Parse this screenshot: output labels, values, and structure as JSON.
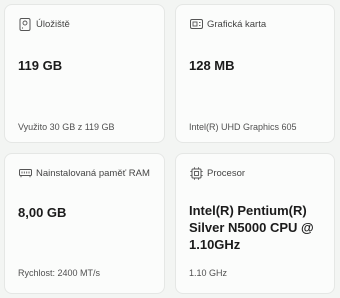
{
  "cards": [
    {
      "icon": "storage-icon",
      "label": "Úložiště",
      "value": "119 GB",
      "detail": "Využito 30 GB z 119 GB"
    },
    {
      "icon": "graphics-card-icon",
      "label": "Grafická karta",
      "value": "128 MB",
      "detail": "Intel(R) UHD Graphics 605"
    },
    {
      "icon": "ram-icon",
      "label": "Nainstalovaná paměť RAM",
      "value": "8,00 GB",
      "detail": "Rychlost: 2400 MT/s"
    },
    {
      "icon": "processor-icon",
      "label": "Procesor",
      "value": "Intel(R) Pentium(R) Silver N5000 CPU @ 1.10GHz",
      "detail": "1.10 GHz"
    }
  ],
  "colors": {
    "background": "#f3f5f3",
    "card": "#fbfcfb",
    "border": "#e5e7e5",
    "icon_stroke": "#555555"
  }
}
